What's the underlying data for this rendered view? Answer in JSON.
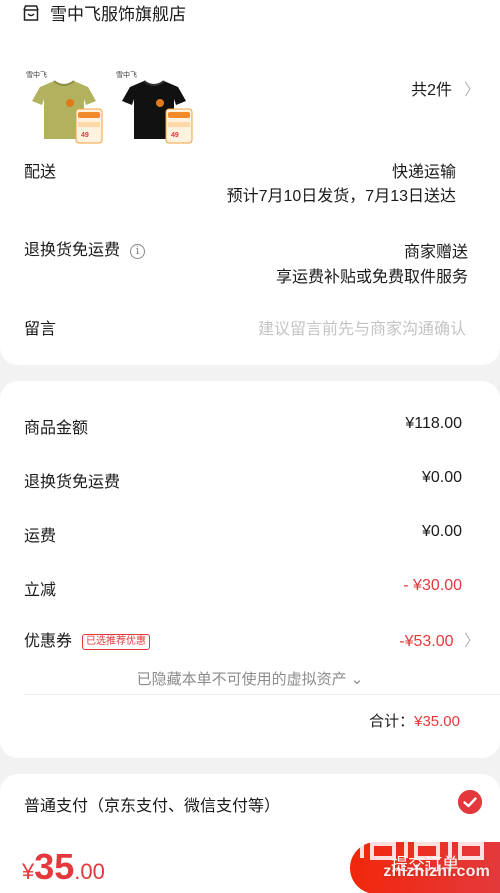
{
  "colors": {
    "accent": "#e4393c",
    "muted": "#8c8c8c",
    "placeholder": "#c4c4c4"
  },
  "shop": {
    "name": "雪中飞服饰旗舰店",
    "icon": "shop-icon"
  },
  "products": {
    "count_label": "共2件",
    "items": [
      {
        "color": "olive-green",
        "tag_price": "49"
      },
      {
        "color": "black",
        "tag_price": "49"
      }
    ]
  },
  "delivery": {
    "label": "配送",
    "method": "快递运输",
    "schedule": "预计7月10日发货，7月13日送达"
  },
  "return_shipping": {
    "label": "退换货免运费",
    "value": "商家赠送",
    "detail": "享运费补贴或免费取件服务"
  },
  "message": {
    "label": "留言",
    "placeholder": "建议留言前先与商家沟通确认"
  },
  "price_summary": {
    "goods_amount_label": "商品金额",
    "goods_amount": "¥118.00",
    "return_fee_label": "退换货免运费",
    "return_fee": "¥0.00",
    "freight_label": "运费",
    "freight": "¥0.00",
    "discount_label": "立减",
    "discount": "- ¥30.00",
    "coupon_label": "优惠券",
    "coupon_badge": "已选推荐优惠",
    "coupon": "-¥53.00",
    "hidden_assets": "已隐藏本单不可使用的虚拟资产",
    "total_label": "合计：",
    "total": "¥35.00"
  },
  "payment": {
    "label": "普通支付（京东支付、微信支付等）",
    "selected": true
  },
  "footer": {
    "currency": "¥",
    "price_int": "35",
    "price_dec": ".00",
    "submit_label": "提交订单",
    "watermark": "zhizhizhi.com"
  }
}
